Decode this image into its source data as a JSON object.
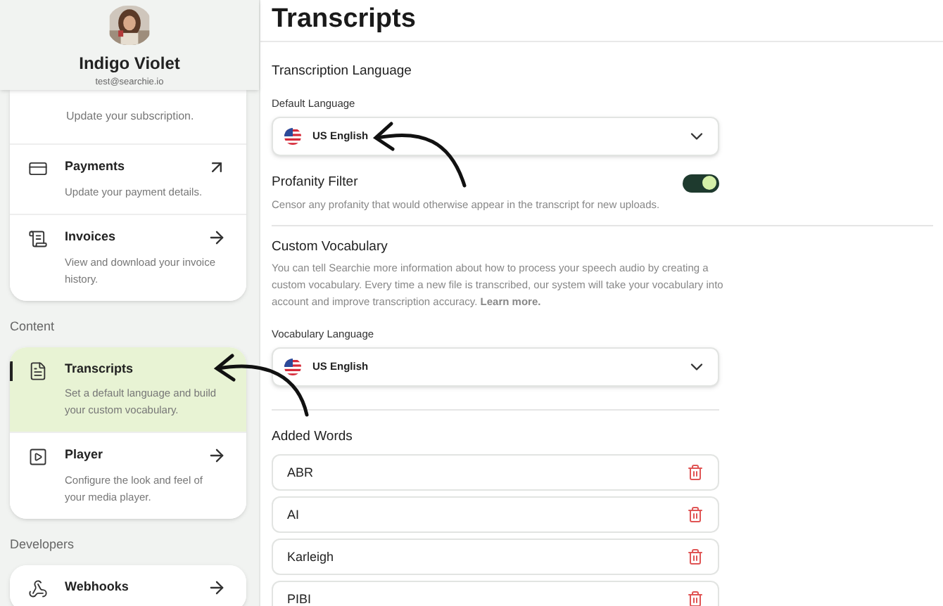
{
  "profile": {
    "name": "Indigo Violet",
    "email": "test@searchie.io"
  },
  "sidebar": {
    "groups": [
      {
        "items": [
          {
            "kind": "partial",
            "description": "Update your subscription."
          },
          {
            "kind": "card",
            "title": "Payments",
            "description": "Update your payment details.",
            "external": true,
            "selected": false
          },
          {
            "kind": "invoice",
            "title": "Invoices",
            "description": "View and download your invoice history.",
            "external": false,
            "selected": false
          }
        ]
      },
      {
        "heading": "Content",
        "items": [
          {
            "kind": "transcript",
            "title": "Transcripts",
            "description": "Set a default language and build your custom vocabulary.",
            "selected": true
          },
          {
            "kind": "player",
            "title": "Player",
            "description": "Configure the look and feel of your media player.",
            "external": false,
            "selected": false
          }
        ]
      },
      {
        "heading": "Developers",
        "items": [
          {
            "kind": "webhook",
            "title": "Webhooks",
            "external": false,
            "selected": false
          }
        ]
      }
    ]
  },
  "page": {
    "title": "Transcripts",
    "transcription": {
      "heading": "Transcription Language",
      "label": "Default Language",
      "value": "US English"
    },
    "profanity": {
      "title": "Profanity Filter",
      "description": "Censor any profanity that would otherwise appear in the transcript for new uploads.",
      "on": true
    },
    "vocabulary": {
      "heading": "Custom Vocabulary",
      "description": "You can tell Searchie more information about how to process your speech audio by creating a custom vocabulary. Every time a new file is transcribed, our system will take your vocabulary into account and improve transcription accuracy. **Learn more.**",
      "label": "Vocabulary Language",
      "value": "US English"
    },
    "added_words": {
      "heading": "Added Words",
      "words": [
        "ABR",
        "AI",
        "Karleigh",
        "PIBI"
      ]
    }
  }
}
